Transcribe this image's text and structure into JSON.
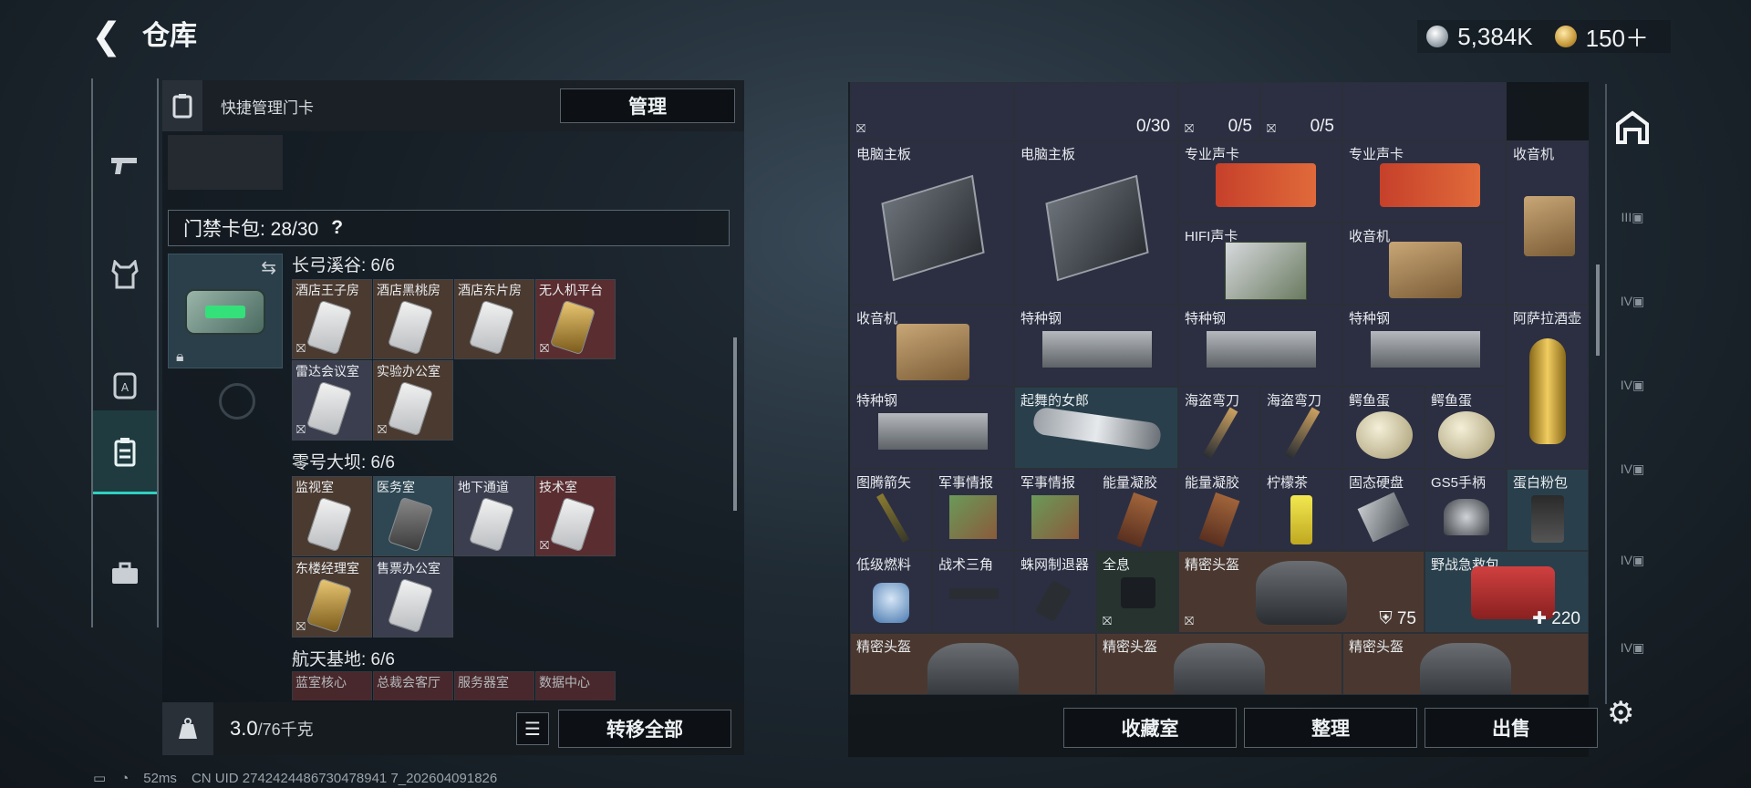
{
  "header": {
    "back_icon": "back-arrow-icon",
    "title": "仓库",
    "currency_primary": "5,384K",
    "currency_secondary": "150＋"
  },
  "left_nav": [
    "gun-icon",
    "armor-icon",
    "backpack-icon",
    "keycard-icon",
    "briefcase-icon"
  ],
  "keycard_panel": {
    "header_label": "快捷管理门卡",
    "manage_button": "管理",
    "bag_label": "门禁卡包: 28/30",
    "help": "?",
    "groups": [
      {
        "name": "长弓溪谷: 6/6",
        "cards": [
          "酒店王子房",
          "酒店黑桃房",
          "酒店东片房",
          "无人机平台",
          "雷达会议室",
          "实验办公室"
        ]
      },
      {
        "name": "零号大坝: 6/6",
        "cards": [
          "监视室",
          "医务室",
          "地下通道",
          "技术室",
          "东楼经理室",
          "售票办公室"
        ]
      },
      {
        "name": "航天基地: 6/6",
        "cards": [
          "蓝室核心",
          "总裁会客厅",
          "服务器室",
          "数据中心"
        ]
      }
    ],
    "weight": "3.0",
    "weight_max": "/76千克",
    "transfer_all": "转移全部"
  },
  "storage": {
    "top_row": [
      {
        "count": "0/30"
      },
      {
        "count": "0/5"
      },
      {
        "count": "0/5"
      }
    ],
    "items": {
      "r1": [
        "电脑主板",
        "电脑主板",
        "专业声卡",
        "专业声卡",
        "收音机"
      ],
      "r2": [
        "HIFI声卡",
        "收音机"
      ],
      "r3": [
        "收音机",
        "特种钢",
        "特种钢",
        "特种钢",
        "阿萨拉酒壶"
      ],
      "r4": [
        "特种钢",
        "起舞的女郎",
        "海盗弯刀",
        "海盗弯刀",
        "鳄鱼蛋",
        "鳄鱼蛋"
      ],
      "r5": [
        "图腾箭矢",
        "军事情报",
        "军事情报",
        "能量凝胶",
        "能量凝胶",
        "柠檬茶",
        "固态硬盘",
        "GS5手柄",
        "蛋白粉包"
      ],
      "r6": [
        "低级燃料",
        "战术三角",
        "蛛网制退器",
        "全息",
        "精密头盔",
        "野战急救包"
      ],
      "r7": [
        "精密头盔",
        "精密头盔",
        "精密头盔"
      ]
    },
    "helmet_durability": "75",
    "medkit_value": "220",
    "buttons": {
      "collection": "收藏室",
      "organize": "整理",
      "sell": "出售"
    }
  },
  "status": {
    "ping": "52ms",
    "uid": "CN UID 2742424486730478941 7_202604091826"
  },
  "colors": {
    "accent": "#2fd0c0",
    "panel": "#161b20"
  }
}
